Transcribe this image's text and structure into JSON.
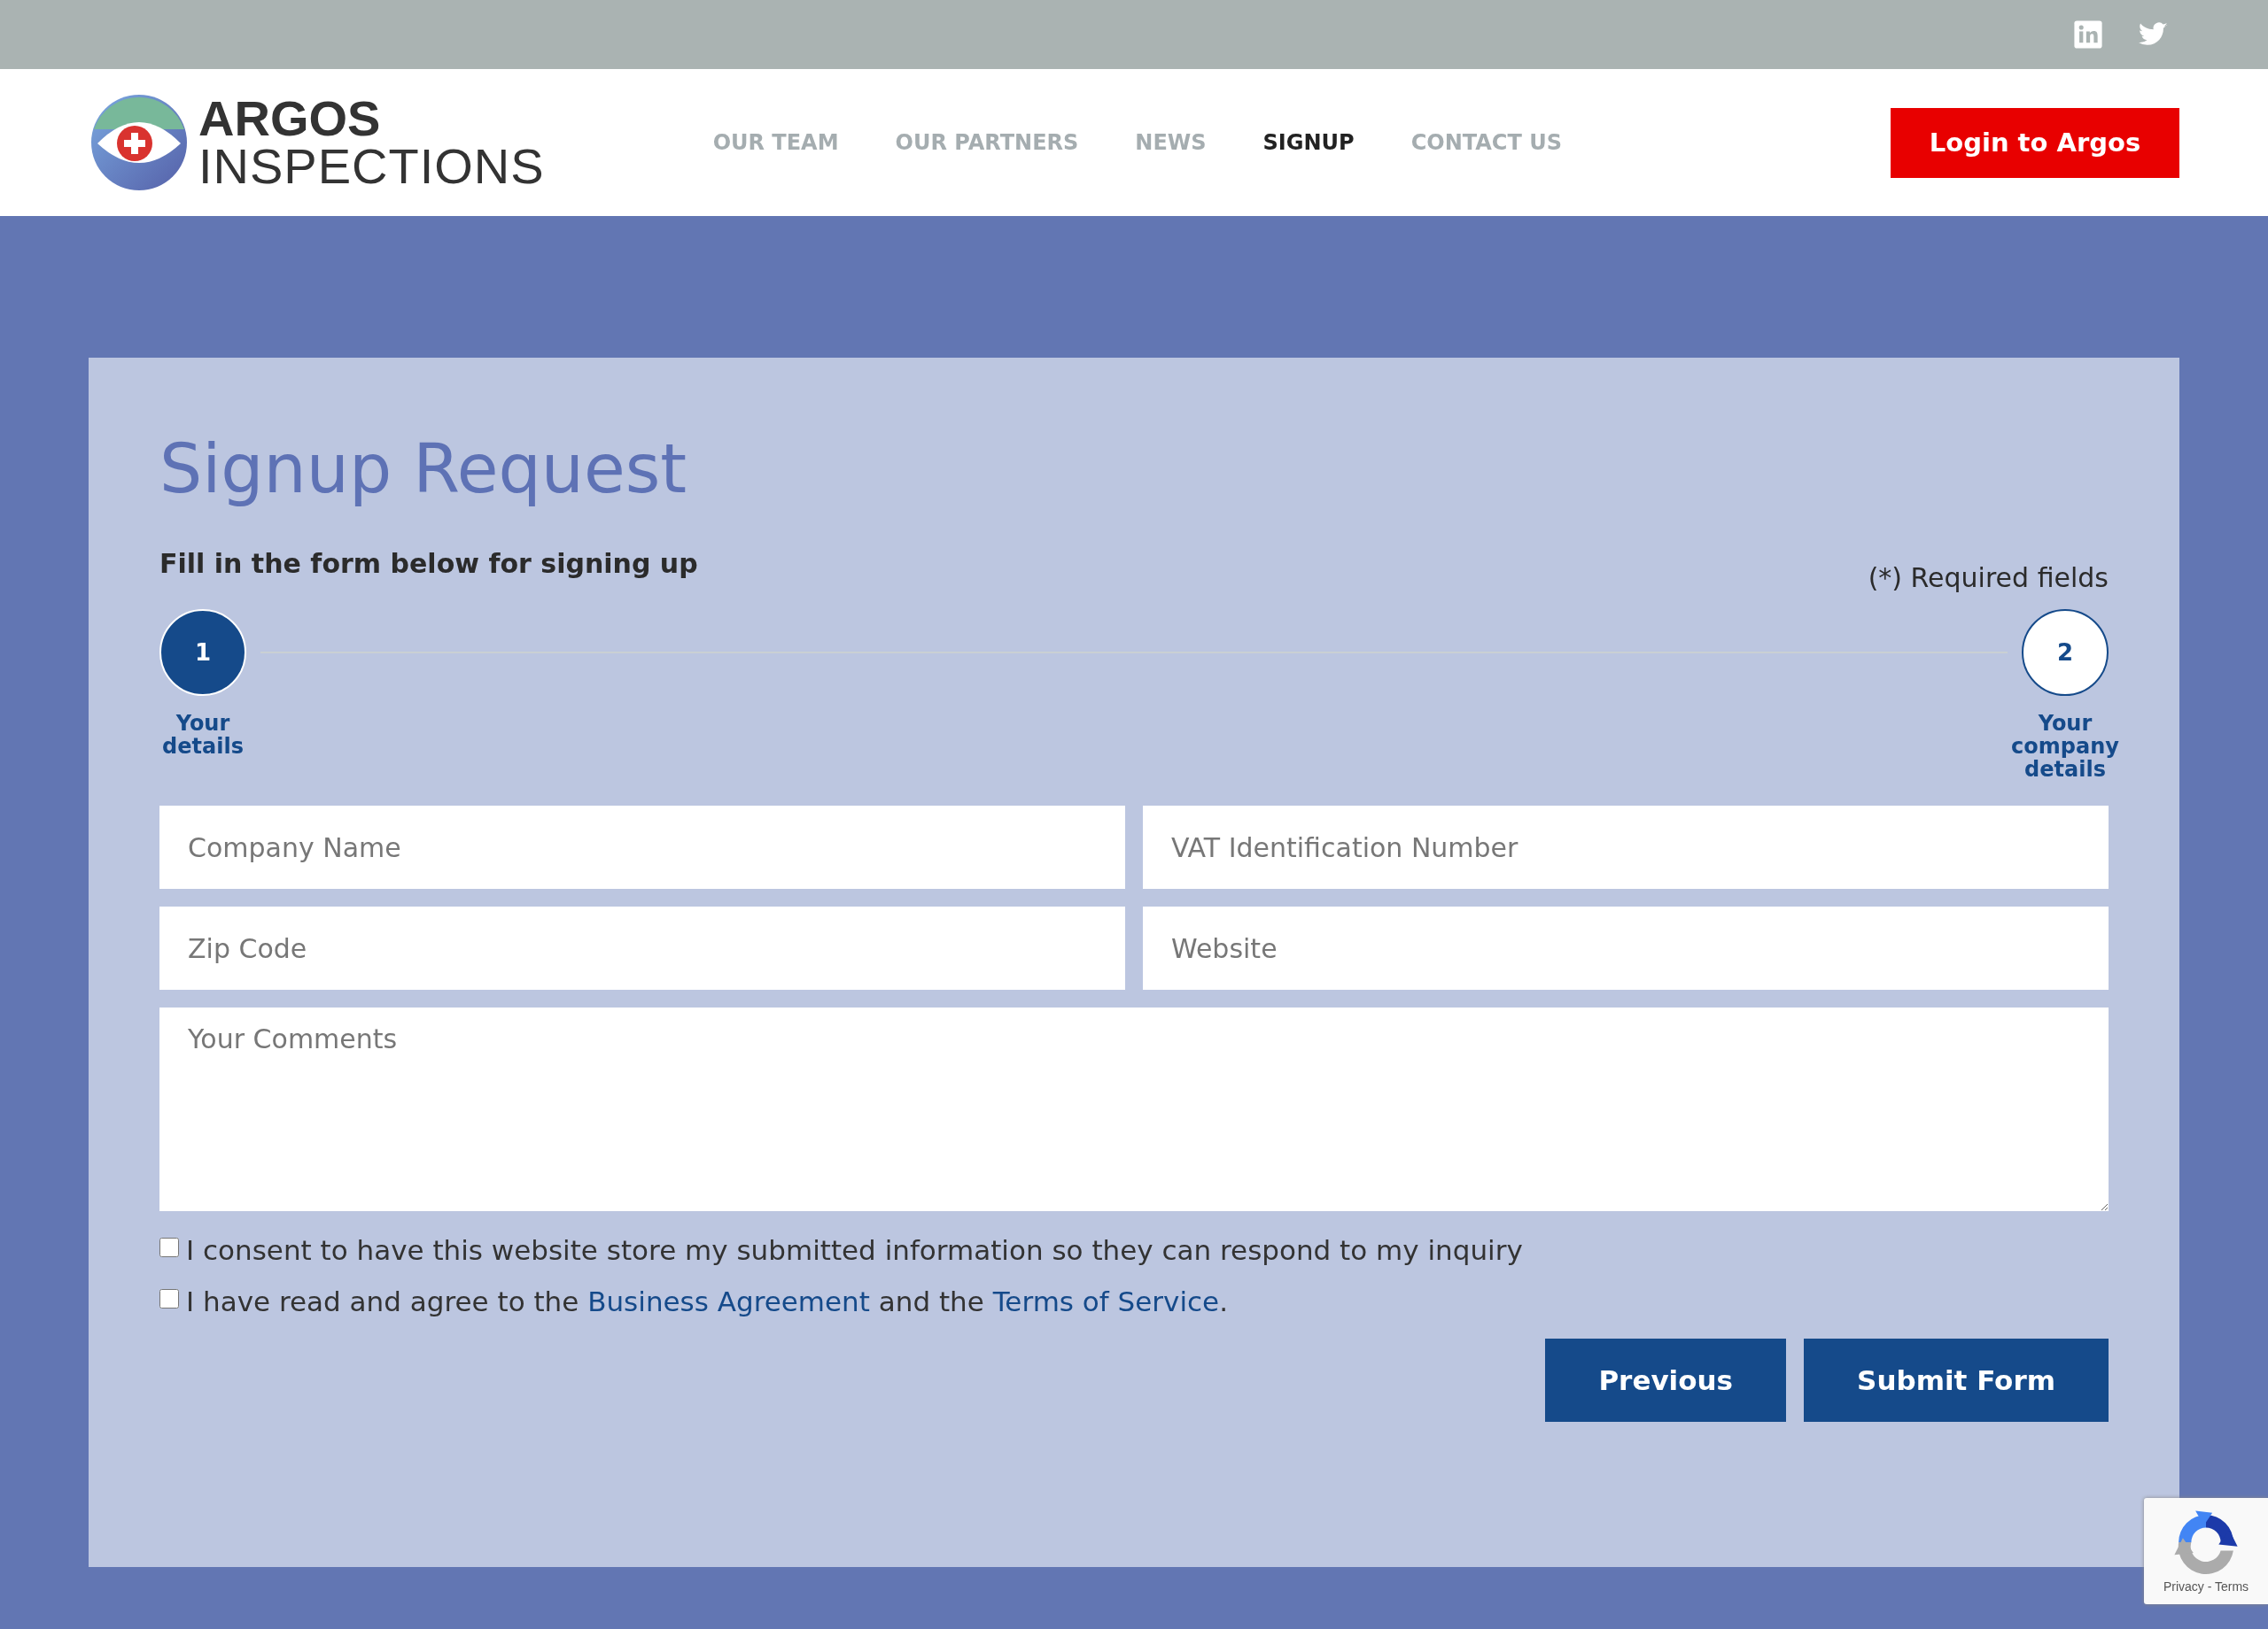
{
  "top_bar": {
    "social": [
      {
        "kind": "linkedin"
      },
      {
        "kind": "twitter"
      }
    ]
  },
  "header": {
    "logo": {
      "line1": "ARGOS",
      "line2": "INSPECTIONS"
    },
    "nav": [
      {
        "label": "OUR TEAM",
        "selected": false
      },
      {
        "label": "OUR PARTNERS",
        "selected": false
      },
      {
        "label": "NEWS",
        "selected": false
      },
      {
        "label": "SIGNUP",
        "selected": true
      },
      {
        "label": "CONTACT US",
        "selected": false
      }
    ],
    "login_button": "Login to Argos"
  },
  "form": {
    "title": "Signup Request",
    "subtitle": "Fill in the form below for signing up",
    "required_note": "(*) Required fields",
    "steps": [
      {
        "number": "1",
        "label": "Your details",
        "selected": true
      },
      {
        "number": "2",
        "label": "Your company details",
        "selected": false
      }
    ],
    "fields": [
      {
        "kind": "input",
        "placeholder": "Company Name"
      },
      {
        "kind": "input",
        "placeholder": "VAT Identification Number"
      },
      {
        "kind": "input",
        "placeholder": "Zip Code"
      },
      {
        "kind": "input",
        "placeholder": "Website"
      },
      {
        "kind": "textarea",
        "placeholder": "Your Comments"
      }
    ],
    "checkboxes": [
      {
        "checked": false,
        "segments": [
          {
            "kind": "text",
            "text": "I consent to have this website store my submitted information so they can respond to my inquiry"
          }
        ]
      },
      {
        "checked": false,
        "segments": [
          {
            "kind": "text",
            "text": "I have read and agree to the"
          },
          {
            "kind": "link",
            "text": "Business Agreement"
          },
          {
            "kind": "text",
            "text": "and the"
          },
          {
            "kind": "link",
            "text": "Terms of Service"
          },
          {
            "kind": "text",
            "text": "."
          }
        ]
      }
    ],
    "buttons": [
      "Previous",
      "Submit Form"
    ]
  },
  "recaptcha": {
    "text": "Privacy - Terms"
  }
}
